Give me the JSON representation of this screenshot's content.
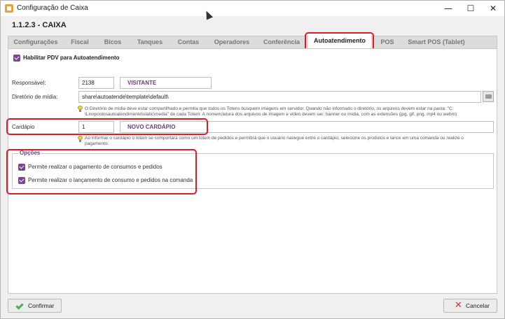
{
  "window": {
    "title": "Configuração de Caixa",
    "controls": {
      "minimize": "—",
      "maximize": "☐",
      "close": "✕"
    }
  },
  "heading": "1.1.2.3 - CAIXA",
  "tabs": [
    {
      "label": "Configurações",
      "active": false
    },
    {
      "label": "Fiscal",
      "active": false
    },
    {
      "label": "Bicos",
      "active": false
    },
    {
      "label": "Tanques",
      "active": false
    },
    {
      "label": "Contas",
      "active": false
    },
    {
      "label": "Operadores",
      "active": false
    },
    {
      "label": "Conferência",
      "active": false
    },
    {
      "label": "Autoatendimento",
      "active": true
    },
    {
      "label": "POS",
      "active": false
    },
    {
      "label": "Smart POS (Tablet)",
      "active": false
    }
  ],
  "form": {
    "enable_label": "Habilitar PDV para Autoatendimento",
    "responsavel_label": "Responsável:",
    "responsavel_code": "2138",
    "responsavel_name": "VISITANTE",
    "diretorio_label": "Diretório de mídia:",
    "diretorio_value": "share\\autoatende\\template\\default\\",
    "diretorio_hint_1": "O Diretório de mídia deve estar compartilhado e permita que todos os Totens busquem imagens em servidor. Quando não informado o diretório, os arquivos devem estar na pasta: \"C:",
    "diretorio_hint_2": "\\Linxpostosautoatendimento\\static\\media\" de cada Totem. A nomenclatura dos arquivos de imagem e video devem ser: banner ou mídia, com as extensões (jpg, gif, png, mp4 ou webm)",
    "cardapio_label": "Cardápio",
    "cardapio_code": "1",
    "cardapio_name": "NOVO CARDÁPIO",
    "cardapio_hint_1": "Ao informar o cardápio o totem se comportará como um totem de pedidos e permitirá que o usuário navegue entre o cardápio, selecione os produtos e lance em uma comanda ou realize o",
    "cardapio_hint_2": "pagamento.",
    "opcoes_legend": "Opções",
    "opcao_1": "Permite realizar o pagamento de consumos e pedidos",
    "opcao_2": "Permite realizar o lançamento de consumo e pedidos na comanda"
  },
  "footer": {
    "confirm_label": "Confirmar",
    "cancel_label": "Cancelar"
  },
  "colors": {
    "accent": "#7a4596",
    "highlight": "#e01b24"
  }
}
